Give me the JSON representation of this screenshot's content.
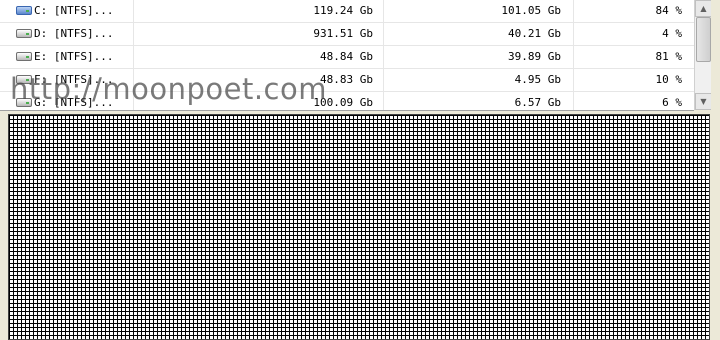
{
  "drives": [
    {
      "name": "C: [NTFS]...",
      "total": "119.24 Gb",
      "free": "101.05 Gb",
      "percent": "84 %",
      "icon": "system-drive-icon"
    },
    {
      "name": "D: [NTFS]...",
      "total": "931.51 Gb",
      "free": "40.21 Gb",
      "percent": "4 %",
      "icon": "hard-drive-icon"
    },
    {
      "name": "E: [NTFS]...",
      "total": "48.84 Gb",
      "free": "39.89 Gb",
      "percent": "81 %",
      "icon": "hard-drive-icon"
    },
    {
      "name": "F: [NTFS]...",
      "total": "48.83 Gb",
      "free": "4.95 Gb",
      "percent": "10 %",
      "icon": "hard-drive-icon"
    },
    {
      "name": "G: [NTFS]...",
      "total": "100.09 Gb",
      "free": "6.57 Gb",
      "percent": "6 %",
      "icon": "hard-drive-icon"
    }
  ],
  "scrollbar": {
    "up": "▲",
    "down": "▼"
  },
  "watermark": "http://moonpoet.com",
  "colors": {
    "system_drive": "#5a86cc",
    "grid": "#000000",
    "background": "#ece9d8"
  }
}
